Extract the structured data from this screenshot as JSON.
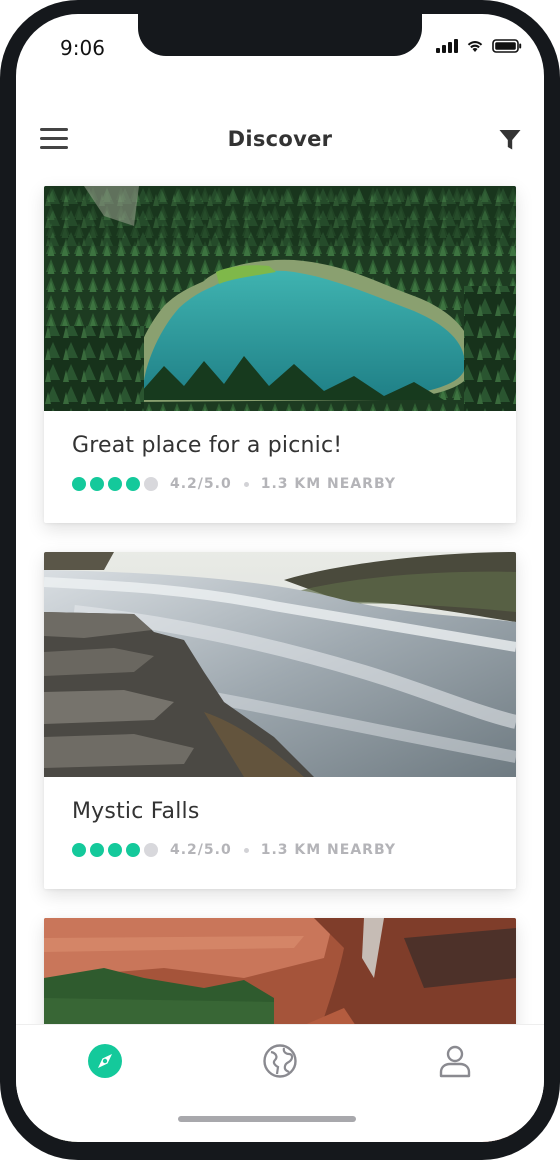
{
  "status_bar": {
    "time": "9:06"
  },
  "header": {
    "title": "Discover"
  },
  "colors": {
    "accent": "#14c99b",
    "inactive_dot": "#d8d8dc",
    "meta_text": "#b4b4b8",
    "tab_inactive": "#8a8a90"
  },
  "icons": {
    "menu": "hamburger-icon",
    "filter": "funnel-icon",
    "discover_tab": "compass-icon",
    "explore_tab": "globe-icon",
    "profile_tab": "user-icon"
  },
  "cards": [
    {
      "title": "Great place for a picnic!",
      "rating": "4.2/5.0",
      "distance": "1.3 KM NEARBY",
      "filled_dots": 4,
      "total_dots": 5,
      "image": "forest lake aerial"
    },
    {
      "title": "Mystic Falls",
      "rating": "4.2/5.0",
      "distance": "1.3 KM NEARBY",
      "filled_dots": 4,
      "total_dots": 5,
      "image": "waterfall over rocks"
    },
    {
      "image": "red rock canyon"
    }
  ],
  "tabs": [
    {
      "name": "discover",
      "active": true
    },
    {
      "name": "explore",
      "active": false
    },
    {
      "name": "profile",
      "active": false
    }
  ]
}
